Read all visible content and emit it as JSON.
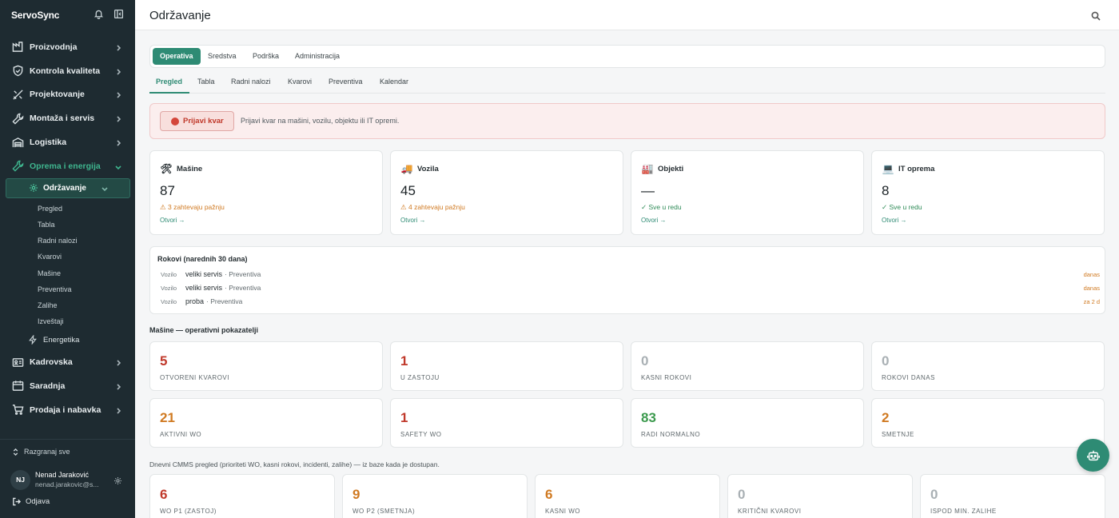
{
  "app": {
    "brand": "ServoSync"
  },
  "sidebar": {
    "items": [
      {
        "label": "Proizvodnja",
        "icon": "factory-icon"
      },
      {
        "label": "Kontrola kvaliteta",
        "icon": "shield-icon"
      },
      {
        "label": "Projektovanje",
        "icon": "design-tools-icon"
      },
      {
        "label": "Montaža i servis",
        "icon": "wrench-icon"
      },
      {
        "label": "Logistika",
        "icon": "warehouse-icon"
      },
      {
        "label": "Oprema i energija",
        "icon": "wrench-screwdriver-icon"
      }
    ],
    "active_sub": "Održavanje",
    "sub_items": [
      "Pregled",
      "Tabla",
      "Radni nalozi",
      "Kvarovi",
      "Mašine",
      "Preventiva",
      "Zalihe",
      "Izveštaji"
    ],
    "energy": "Energetika",
    "items_after": [
      {
        "label": "Kadrovska",
        "icon": "id-card-icon"
      },
      {
        "label": "Saradnja",
        "icon": "calendar-icon"
      },
      {
        "label": "Prodaja i nabavka",
        "icon": "cart-icon"
      }
    ],
    "expand_all": "Razgranaj sve",
    "user": {
      "initials": "NJ",
      "name": "Nenad Jaraković",
      "email": "nenad.jarakovic@s..."
    },
    "logout": "Odjava"
  },
  "header": {
    "title": "Održavanje"
  },
  "tabs": [
    "Operativa",
    "Sredstva",
    "Podrška",
    "Administracija"
  ],
  "subtabs": [
    "Pregled",
    "Tabla",
    "Radni nalozi",
    "Kvarovi",
    "Preventiva",
    "Kalendar"
  ],
  "report": {
    "button": "Prijavi kvar",
    "desc": "Prijavi kvar na mašini, vozilu, objektu ili IT opremi."
  },
  "categories": [
    {
      "title": "Mašine",
      "icon": "🛠",
      "value": "87",
      "status": "⚠ 3 zahtevaju pažnju",
      "open": "Otvori →"
    },
    {
      "title": "Vozila",
      "icon": "🚚",
      "value": "45",
      "status": "⚠ 4 zahtevaju pažnju",
      "open": "Otvori →"
    },
    {
      "title": "Objekti",
      "icon": "🏭",
      "value": "—",
      "status": "✓ Sve u redu",
      "open": "Otvori →"
    },
    {
      "title": "IT oprema",
      "icon": "💻",
      "value": "8",
      "status": "✓ Sve u redu",
      "open": "Otvori →"
    }
  ],
  "deadlines": {
    "title": "Rokovi (narednih 30 dana)",
    "rows": [
      {
        "type": "Vozilo",
        "name": "veliki servis",
        "kind": "· Preventiva",
        "when": "danas"
      },
      {
        "type": "Vozilo",
        "name": "veliki servis",
        "kind": "· Preventiva",
        "when": "danas"
      },
      {
        "type": "Vozilo",
        "name": "proba",
        "kind": "· Preventiva",
        "when": "za 2 d"
      }
    ]
  },
  "kpis": {
    "title": "Mašine — operativni pokazatelji",
    "cards": [
      {
        "value": "5",
        "label": "Otvoreni kvarovi",
        "color": "#c0392b"
      },
      {
        "value": "1",
        "label": "U zastoju",
        "color": "#c0392b"
      },
      {
        "value": "0",
        "label": "Kasni rokovi",
        "color": "#a9b0b4"
      },
      {
        "value": "0",
        "label": "Rokovi danas",
        "color": "#a9b0b4"
      },
      {
        "value": "21",
        "label": "Aktivni WO",
        "color": "#d07a22"
      },
      {
        "value": "1",
        "label": "Safety WO",
        "color": "#c0392b"
      },
      {
        "value": "83",
        "label": "Radi normalno",
        "color": "#3c9a4e"
      },
      {
        "value": "2",
        "label": "Smetnje",
        "color": "#d07a22"
      }
    ]
  },
  "cmms": {
    "note": "Dnevni CMMS pregled (prioriteti WO, kasni rokovi, incidenti, zalihe) — iz baze kada je dostupan.",
    "cards": [
      {
        "value": "6",
        "label": "WO P1 (zastoj)",
        "color": "#c0392b"
      },
      {
        "value": "9",
        "label": "WO P2 (smetnja)",
        "color": "#d07a22"
      },
      {
        "value": "6",
        "label": "Kasni WO",
        "color": "#d07a22"
      },
      {
        "value": "0",
        "label": "Kritični kvarovi",
        "color": "#a9b0b4"
      },
      {
        "value": "0",
        "label": "Ispod min. zalihe",
        "color": "#a9b0b4"
      }
    ]
  }
}
